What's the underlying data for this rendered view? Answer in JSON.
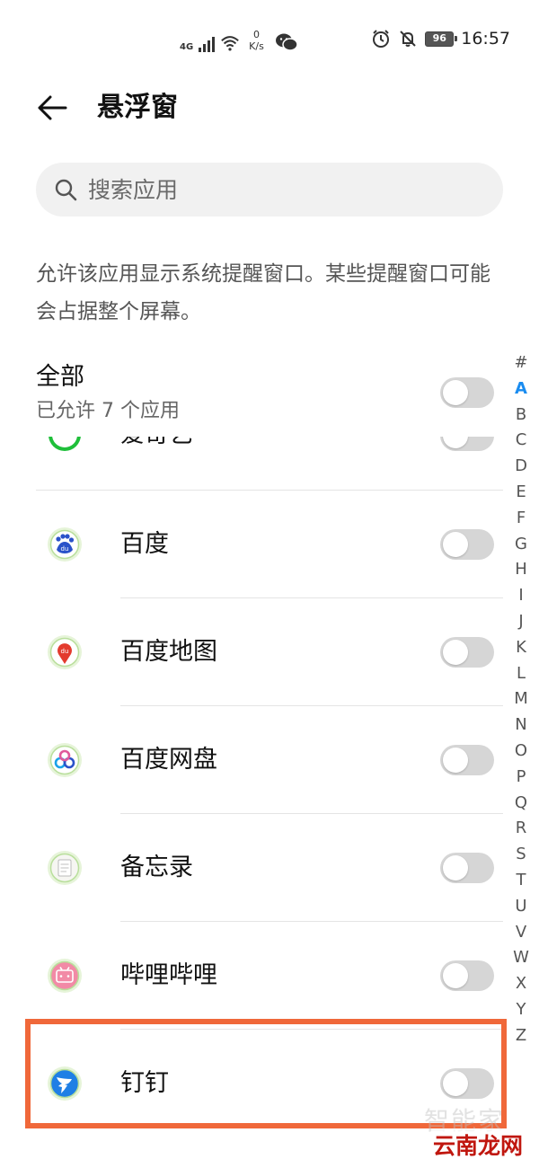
{
  "status_bar": {
    "network": "4G",
    "speed_value": "0",
    "speed_unit": "K/s",
    "battery": "96",
    "time": "16:57",
    "icons": [
      "signal-icon",
      "wifi-icon",
      "wechat-icon",
      "alarm-icon",
      "mute-icon",
      "battery-icon"
    ]
  },
  "header": {
    "title": "悬浮窗",
    "back_icon": "arrow-left-icon"
  },
  "search": {
    "placeholder": "搜索应用",
    "value": ""
  },
  "description": "允许该应用显示系统提醒窗口。某些提醒窗口可能会占据整个屏幕。",
  "all": {
    "title": "全部",
    "subtitle": "已允许 7 个应用",
    "enabled": false
  },
  "apps": [
    {
      "label": "爱奇艺",
      "icon": "iqiyi-icon",
      "enabled": false,
      "partial": true
    },
    {
      "label": "百度",
      "icon": "baidu-icon",
      "enabled": false
    },
    {
      "label": "百度地图",
      "icon": "baidu-map-icon",
      "enabled": false
    },
    {
      "label": "百度网盘",
      "icon": "baidu-netdisk-icon",
      "enabled": false
    },
    {
      "label": "备忘录",
      "icon": "notepad-icon",
      "enabled": false
    },
    {
      "label": "哔哩哔哩",
      "icon": "bilibili-icon",
      "enabled": false
    },
    {
      "label": "钉钉",
      "icon": "dingtalk-icon",
      "enabled": false,
      "highlighted": true
    }
  ],
  "index_letters": [
    "#",
    "A",
    "B",
    "C",
    "D",
    "E",
    "F",
    "G",
    "H",
    "I",
    "J",
    "K",
    "L",
    "M",
    "N",
    "O",
    "P",
    "Q",
    "R",
    "S",
    "T",
    "U",
    "V",
    "W",
    "X",
    "Y",
    "Z"
  ],
  "active_letter": "A",
  "watermark": {
    "back": "智能家",
    "front": "云南龙网"
  },
  "colors": {
    "accent": "#1a8cf0",
    "highlight": "#f0683a",
    "toggle_off": "#d6d6d6"
  }
}
